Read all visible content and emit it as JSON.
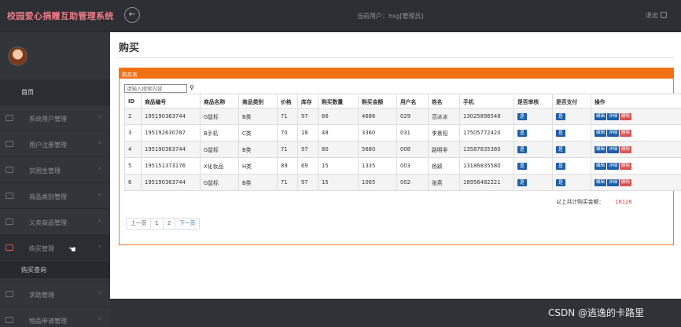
{
  "app": {
    "title": "校园爱心捐赠互助管理系统",
    "current_user": "当前用户：hsg[管理员]",
    "logout": "退出"
  },
  "sidebar": {
    "home": "首页",
    "items": [
      {
        "label": "系统用户管理"
      },
      {
        "label": "用户注册管理"
      },
      {
        "label": "贫困生管理"
      },
      {
        "label": "商品类别管理"
      },
      {
        "label": "义卖商品管理"
      },
      {
        "label": "购买管理"
      },
      {
        "label": "求助管理"
      },
      {
        "label": "物品申请管理"
      }
    ],
    "active_sub": "购买查询"
  },
  "page": {
    "title": "购买",
    "panel_title": "购买表",
    "search_placeholder": "请输入搜索内容"
  },
  "table": {
    "headers": [
      "ID",
      "商品编号",
      "商品名称",
      "商品类别",
      "价格",
      "库存",
      "购买数量",
      "购买金额",
      "用户名",
      "姓名",
      "手机",
      "是否审核",
      "是否支付",
      "操作"
    ],
    "rows": [
      {
        "id": "2",
        "code": "195190363744",
        "name": "G鼠标",
        "cat": "B类",
        "price": "71",
        "stock": "97",
        "qty": "66",
        "amount": "4686",
        "user": "029",
        "realname": "范冰冰",
        "phone": "13025896548",
        "audit": "是",
        "paid": "是"
      },
      {
        "id": "3",
        "code": "195192630787",
        "name": "B手机",
        "cat": "C类",
        "price": "70",
        "stock": "18",
        "qty": "48",
        "amount": "3360",
        "user": "031",
        "realname": "李景阳",
        "phone": "17505772420",
        "audit": "是",
        "paid": "是"
      },
      {
        "id": "4",
        "code": "195190363744",
        "name": "G鼠标",
        "cat": "B类",
        "price": "71",
        "stock": "97",
        "qty": "80",
        "amount": "5680",
        "user": "008",
        "realname": "路明非",
        "phone": "13587835380",
        "audit": "是",
        "paid": "是"
      },
      {
        "id": "5",
        "code": "195151373176",
        "name": "X化妆品",
        "cat": "H类",
        "price": "89",
        "stock": "69",
        "qty": "15",
        "amount": "1335",
        "user": "003",
        "realname": "杨颖",
        "phone": "13186835580",
        "audit": "是",
        "paid": "是"
      },
      {
        "id": "6",
        "code": "195190363744",
        "name": "G鼠标",
        "cat": "B类",
        "price": "71",
        "stock": "97",
        "qty": "15",
        "amount": "1065",
        "user": "002",
        "realname": "张燕",
        "phone": "18956482221",
        "audit": "是",
        "paid": "是"
      }
    ],
    "actions": {
      "edit": "编辑",
      "detail": "详细",
      "delete": "删除"
    }
  },
  "summary": {
    "label": "以上共计购买金额：",
    "value": "16126"
  },
  "pager": {
    "prev": "上一页",
    "pages": [
      "1",
      "2"
    ],
    "next": "下一页"
  },
  "watermark": "CSDN @逃逸的卡路里",
  "colors": {
    "accent": "#f36f14",
    "brand": "#f07d8a",
    "button_blue": "#1e5fa8",
    "button_red": "#d9534f",
    "total_red": "#e23b3b"
  }
}
